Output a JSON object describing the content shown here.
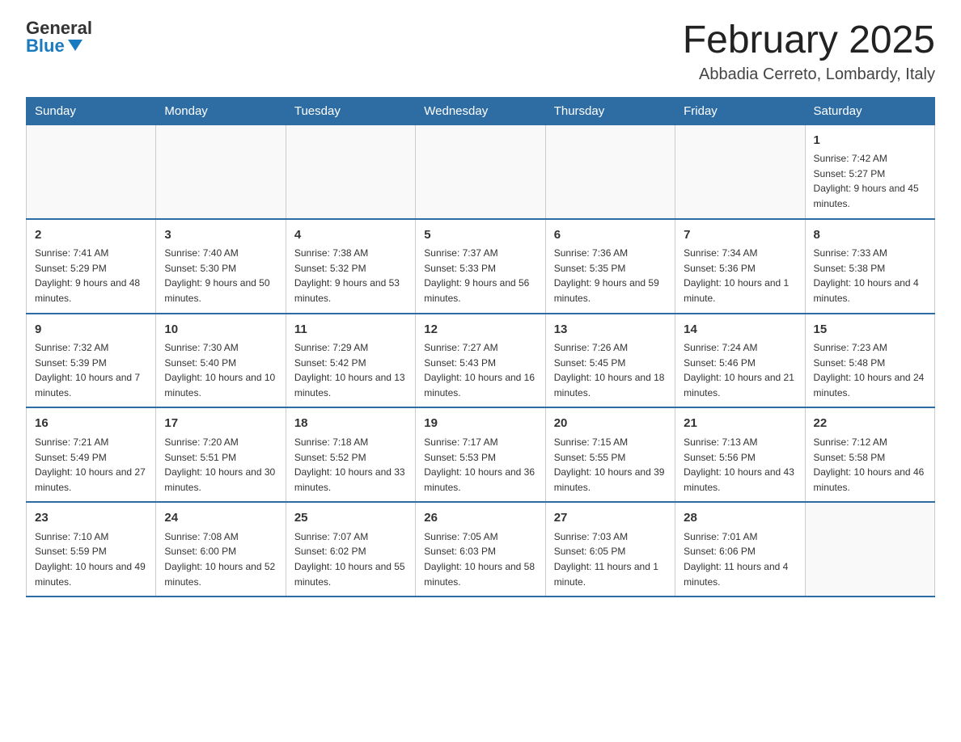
{
  "logo": {
    "general": "General",
    "blue": "Blue"
  },
  "title": "February 2025",
  "location": "Abbadia Cerreto, Lombardy, Italy",
  "days_of_week": [
    "Sunday",
    "Monday",
    "Tuesday",
    "Wednesday",
    "Thursday",
    "Friday",
    "Saturday"
  ],
  "weeks": [
    [
      {
        "day": "",
        "info": ""
      },
      {
        "day": "",
        "info": ""
      },
      {
        "day": "",
        "info": ""
      },
      {
        "day": "",
        "info": ""
      },
      {
        "day": "",
        "info": ""
      },
      {
        "day": "",
        "info": ""
      },
      {
        "day": "1",
        "info": "Sunrise: 7:42 AM\nSunset: 5:27 PM\nDaylight: 9 hours and 45 minutes."
      }
    ],
    [
      {
        "day": "2",
        "info": "Sunrise: 7:41 AM\nSunset: 5:29 PM\nDaylight: 9 hours and 48 minutes."
      },
      {
        "day": "3",
        "info": "Sunrise: 7:40 AM\nSunset: 5:30 PM\nDaylight: 9 hours and 50 minutes."
      },
      {
        "day": "4",
        "info": "Sunrise: 7:38 AM\nSunset: 5:32 PM\nDaylight: 9 hours and 53 minutes."
      },
      {
        "day": "5",
        "info": "Sunrise: 7:37 AM\nSunset: 5:33 PM\nDaylight: 9 hours and 56 minutes."
      },
      {
        "day": "6",
        "info": "Sunrise: 7:36 AM\nSunset: 5:35 PM\nDaylight: 9 hours and 59 minutes."
      },
      {
        "day": "7",
        "info": "Sunrise: 7:34 AM\nSunset: 5:36 PM\nDaylight: 10 hours and 1 minute."
      },
      {
        "day": "8",
        "info": "Sunrise: 7:33 AM\nSunset: 5:38 PM\nDaylight: 10 hours and 4 minutes."
      }
    ],
    [
      {
        "day": "9",
        "info": "Sunrise: 7:32 AM\nSunset: 5:39 PM\nDaylight: 10 hours and 7 minutes."
      },
      {
        "day": "10",
        "info": "Sunrise: 7:30 AM\nSunset: 5:40 PM\nDaylight: 10 hours and 10 minutes."
      },
      {
        "day": "11",
        "info": "Sunrise: 7:29 AM\nSunset: 5:42 PM\nDaylight: 10 hours and 13 minutes."
      },
      {
        "day": "12",
        "info": "Sunrise: 7:27 AM\nSunset: 5:43 PM\nDaylight: 10 hours and 16 minutes."
      },
      {
        "day": "13",
        "info": "Sunrise: 7:26 AM\nSunset: 5:45 PM\nDaylight: 10 hours and 18 minutes."
      },
      {
        "day": "14",
        "info": "Sunrise: 7:24 AM\nSunset: 5:46 PM\nDaylight: 10 hours and 21 minutes."
      },
      {
        "day": "15",
        "info": "Sunrise: 7:23 AM\nSunset: 5:48 PM\nDaylight: 10 hours and 24 minutes."
      }
    ],
    [
      {
        "day": "16",
        "info": "Sunrise: 7:21 AM\nSunset: 5:49 PM\nDaylight: 10 hours and 27 minutes."
      },
      {
        "day": "17",
        "info": "Sunrise: 7:20 AM\nSunset: 5:51 PM\nDaylight: 10 hours and 30 minutes."
      },
      {
        "day": "18",
        "info": "Sunrise: 7:18 AM\nSunset: 5:52 PM\nDaylight: 10 hours and 33 minutes."
      },
      {
        "day": "19",
        "info": "Sunrise: 7:17 AM\nSunset: 5:53 PM\nDaylight: 10 hours and 36 minutes."
      },
      {
        "day": "20",
        "info": "Sunrise: 7:15 AM\nSunset: 5:55 PM\nDaylight: 10 hours and 39 minutes."
      },
      {
        "day": "21",
        "info": "Sunrise: 7:13 AM\nSunset: 5:56 PM\nDaylight: 10 hours and 43 minutes."
      },
      {
        "day": "22",
        "info": "Sunrise: 7:12 AM\nSunset: 5:58 PM\nDaylight: 10 hours and 46 minutes."
      }
    ],
    [
      {
        "day": "23",
        "info": "Sunrise: 7:10 AM\nSunset: 5:59 PM\nDaylight: 10 hours and 49 minutes."
      },
      {
        "day": "24",
        "info": "Sunrise: 7:08 AM\nSunset: 6:00 PM\nDaylight: 10 hours and 52 minutes."
      },
      {
        "day": "25",
        "info": "Sunrise: 7:07 AM\nSunset: 6:02 PM\nDaylight: 10 hours and 55 minutes."
      },
      {
        "day": "26",
        "info": "Sunrise: 7:05 AM\nSunset: 6:03 PM\nDaylight: 10 hours and 58 minutes."
      },
      {
        "day": "27",
        "info": "Sunrise: 7:03 AM\nSunset: 6:05 PM\nDaylight: 11 hours and 1 minute."
      },
      {
        "day": "28",
        "info": "Sunrise: 7:01 AM\nSunset: 6:06 PM\nDaylight: 11 hours and 4 minutes."
      },
      {
        "day": "",
        "info": ""
      }
    ]
  ]
}
